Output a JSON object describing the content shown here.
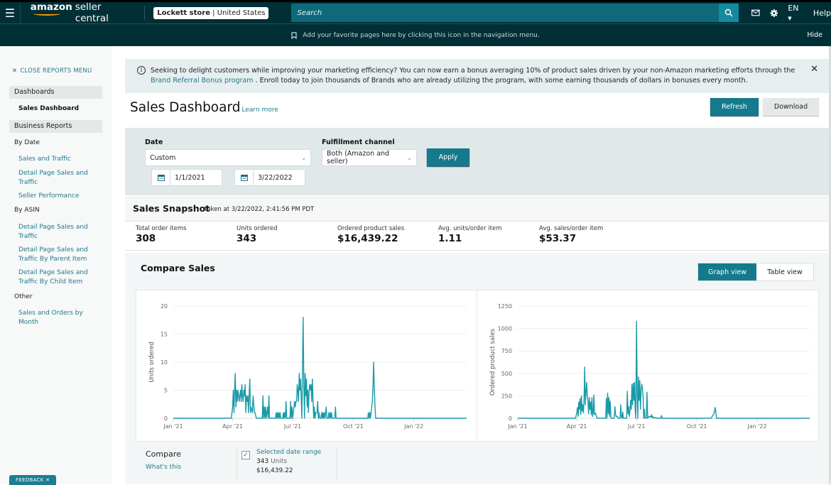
{
  "topbar": {
    "logo_brand": "amazon",
    "logo_text": "seller central",
    "store_name": "Lockett store",
    "store_region": "United States",
    "search_placeholder": "Search",
    "language": "EN",
    "help_label": "Help",
    "icons": [
      "menu-icon",
      "search-icon",
      "mail-icon",
      "gear-icon"
    ]
  },
  "favbar": {
    "message": "Add your favorite pages here by clicking this icon in the navigation menu.",
    "hide_label": "Hide"
  },
  "sidebar": {
    "close_label": "CLOSE REPORTS MENU",
    "groups": {
      "dashboards": "Dashboards",
      "business_reports": "Business Reports"
    },
    "active_item": "Sales Dashboard",
    "by_date": "By Date",
    "by_date_items": [
      "Sales and Traffic",
      "Detail Page Sales and Traffic",
      "Seller Performance"
    ],
    "by_asin": "By ASIN",
    "by_asin_items": [
      "Detail Page Sales and Traffic",
      "Detail Page Sales and Traffic By Parent Item",
      "Detail Page Sales and Traffic By Child Item"
    ],
    "other": "Other",
    "other_items": [
      "Sales and Orders by Month"
    ],
    "feedback_label": "FEEDBACK"
  },
  "banner": {
    "text_before": "Seeking to delight customers while improving your marketing efficiency? You can now earn a bonus averaging 10% of product sales driven by your non-Amazon marketing efforts through the ",
    "link_text": "Brand Referral Bonus program",
    "text_after": " . Enroll today to join thousands of Brands who are already utilizing the program, with some earning thousands of dollars in bonuses every month."
  },
  "page": {
    "title": "Sales Dashboard",
    "learn_more": "Learn more",
    "refresh_label": "Refresh",
    "download_label": "Download"
  },
  "filters": {
    "date_label": "Date",
    "date_value": "Custom",
    "start_date": "1/1/2021",
    "end_date": "3/22/2022",
    "fulfillment_label": "Fulfillment channel",
    "fulfillment_value": "Both (Amazon and seller)",
    "apply_label": "Apply"
  },
  "snapshot": {
    "title": "Sales Snapshot",
    "taken_at": "taken at 3/22/2022, 2:41:56 PM PDT",
    "metrics": [
      {
        "label": "Total order items",
        "value": "308"
      },
      {
        "label": "Units ordered",
        "value": "343"
      },
      {
        "label": "Ordered product sales",
        "value": "$16,439.22"
      },
      {
        "label": "Avg. units/order item",
        "value": "1.11"
      },
      {
        "label": "Avg. sales/order item",
        "value": "$53.37"
      }
    ]
  },
  "compare": {
    "title": "Compare Sales",
    "graph_view": "Graph view",
    "table_view": "Table view",
    "compare_label": "Compare",
    "whats_this": "What's this",
    "selected_range": "Selected date range",
    "units_value": "343",
    "units_word": "Units",
    "sales_value": "$16,439.22"
  },
  "colors": {
    "accent": "#157a8c",
    "nav_bg": "#002f36",
    "line": "#1a9aa8"
  },
  "chart_data": [
    {
      "type": "line",
      "title": "",
      "xlabel": "",
      "ylabel": "Units ordered",
      "ylim": [
        0,
        20
      ],
      "yticks": [
        "0",
        "5",
        "10",
        "15",
        "20"
      ],
      "xticks": [
        "Jan '21",
        "Apr '21",
        "Jul '21",
        "Oct '21",
        "Jan '22"
      ],
      "x_range_days": [
        0,
        445
      ],
      "grid": true,
      "series": [
        {
          "name": "Units ordered",
          "points": [
            [
              0,
              0
            ],
            [
              88,
              0
            ],
            [
              90,
              2
            ],
            [
              91,
              5
            ],
            [
              92,
              1
            ],
            [
              93,
              5
            ],
            [
              94,
              8
            ],
            [
              95,
              2
            ],
            [
              96,
              5
            ],
            [
              97,
              3
            ],
            [
              98,
              5
            ],
            [
              99,
              4
            ],
            [
              100,
              3
            ],
            [
              102,
              5
            ],
            [
              103,
              3
            ],
            [
              104,
              6
            ],
            [
              105,
              4
            ],
            [
              106,
              3
            ],
            [
              107,
              5
            ],
            [
              108,
              4
            ],
            [
              109,
              6
            ],
            [
              110,
              1
            ],
            [
              111,
              4
            ],
            [
              112,
              3
            ],
            [
              113,
              4
            ],
            [
              114,
              1
            ],
            [
              116,
              7
            ],
            [
              117,
              1
            ],
            [
              118,
              2
            ],
            [
              120,
              1
            ],
            [
              121,
              4
            ],
            [
              123,
              1
            ],
            [
              124,
              1
            ],
            [
              126,
              0
            ],
            [
              135,
              0
            ],
            [
              136,
              4
            ],
            [
              137,
              0
            ],
            [
              138,
              2
            ],
            [
              139,
              0
            ],
            [
              140,
              2
            ],
            [
              141,
              0
            ],
            [
              142,
              1
            ],
            [
              143,
              2
            ],
            [
              144,
              0
            ],
            [
              145,
              4
            ],
            [
              146,
              0
            ],
            [
              155,
              0
            ],
            [
              156,
              1
            ],
            [
              157,
              0
            ],
            [
              158,
              1
            ],
            [
              159,
              0
            ],
            [
              160,
              1
            ],
            [
              161,
              0
            ],
            [
              162,
              1
            ],
            [
              163,
              0
            ],
            [
              166,
              0
            ],
            [
              167,
              1
            ],
            [
              168,
              0
            ],
            [
              169,
              1
            ],
            [
              170,
              0
            ],
            [
              171,
              3
            ],
            [
              172,
              0
            ],
            [
              177,
              0
            ],
            [
              178,
              3
            ],
            [
              179,
              0
            ],
            [
              180,
              2
            ],
            [
              181,
              0
            ],
            [
              182,
              1
            ],
            [
              184,
              3
            ],
            [
              185,
              2
            ],
            [
              186,
              3
            ],
            [
              187,
              3
            ],
            [
              188,
              6
            ],
            [
              189,
              5
            ],
            [
              190,
              3
            ],
            [
              191,
              8
            ],
            [
              192,
              5
            ],
            [
              193,
              7
            ],
            [
              194,
              4
            ],
            [
              195,
              0
            ],
            [
              197,
              18
            ],
            [
              198,
              6
            ],
            [
              199,
              0
            ],
            [
              200,
              8
            ],
            [
              201,
              4
            ],
            [
              202,
              7
            ],
            [
              203,
              2
            ],
            [
              204,
              5
            ],
            [
              205,
              1
            ],
            [
              206,
              5
            ],
            [
              207,
              6
            ],
            [
              208,
              5
            ],
            [
              209,
              6
            ],
            [
              210,
              3
            ],
            [
              211,
              7
            ],
            [
              212,
              3
            ],
            [
              213,
              0
            ],
            [
              214,
              2
            ],
            [
              215,
              0
            ],
            [
              216,
              1
            ],
            [
              218,
              1
            ],
            [
              219,
              3
            ],
            [
              220,
              0
            ],
            [
              221,
              1
            ],
            [
              222,
              0
            ],
            [
              224,
              0
            ],
            [
              225,
              1
            ],
            [
              226,
              0
            ],
            [
              227,
              1
            ],
            [
              228,
              0
            ],
            [
              229,
              1
            ],
            [
              230,
              0
            ],
            [
              232,
              2
            ],
            [
              233,
              0
            ],
            [
              235,
              0
            ],
            [
              236,
              1
            ],
            [
              237,
              0
            ],
            [
              238,
              1
            ],
            [
              239,
              0
            ],
            [
              240,
              1
            ],
            [
              241,
              0
            ],
            [
              245,
              0
            ],
            [
              246,
              2
            ],
            [
              247,
              0
            ],
            [
              295,
              0
            ],
            [
              296,
              1
            ],
            [
              297,
              0
            ],
            [
              298,
              1
            ],
            [
              299,
              0
            ],
            [
              300,
              1
            ],
            [
              302,
              3
            ],
            [
              303,
              6
            ],
            [
              304,
              10
            ],
            [
              305,
              5
            ],
            [
              306,
              2
            ],
            [
              307,
              0
            ],
            [
              445,
              0
            ]
          ]
        }
      ]
    },
    {
      "type": "line",
      "title": "",
      "xlabel": "",
      "ylabel": "Ordered product sales",
      "ylim": [
        0,
        1250
      ],
      "yticks": [
        "0",
        "250",
        "500",
        "750",
        "1000",
        "1250"
      ],
      "xticks": [
        "Jan '21",
        "Apr '21",
        "Jul '21",
        "Oct '21",
        "Jan '22"
      ],
      "x_range_days": [
        0,
        445
      ],
      "grid": true,
      "series": [
        {
          "name": "Ordered product sales",
          "points": [
            [
              0,
              0
            ],
            [
              88,
              0
            ],
            [
              90,
              60
            ],
            [
              91,
              120
            ],
            [
              92,
              20
            ],
            [
              93,
              180
            ],
            [
              94,
              100
            ],
            [
              95,
              220
            ],
            [
              96,
              40
            ],
            [
              97,
              250
            ],
            [
              98,
              80
            ],
            [
              99,
              150
            ],
            [
              100,
              60
            ],
            [
              101,
              200
            ],
            [
              102,
              570
            ],
            [
              103,
              150
            ],
            [
              104,
              300
            ],
            [
              105,
              400
            ],
            [
              106,
              250
            ],
            [
              107,
              200
            ],
            [
              108,
              50
            ],
            [
              109,
              230
            ],
            [
              110,
              100
            ],
            [
              111,
              180
            ],
            [
              112,
              40
            ],
            [
              113,
              230
            ],
            [
              114,
              20
            ],
            [
              115,
              60
            ],
            [
              116,
              260
            ],
            [
              117,
              40
            ],
            [
              118,
              60
            ],
            [
              120,
              20
            ],
            [
              121,
              0
            ],
            [
              134,
              0
            ],
            [
              135,
              220
            ],
            [
              136,
              0
            ],
            [
              137,
              280
            ],
            [
              138,
              50
            ],
            [
              139,
              230
            ],
            [
              140,
              20
            ],
            [
              141,
              190
            ],
            [
              142,
              0
            ],
            [
              147,
              0
            ],
            [
              148,
              130
            ],
            [
              149,
              50
            ],
            [
              150,
              20
            ],
            [
              152,
              20
            ],
            [
              153,
              0
            ],
            [
              156,
              0
            ],
            [
              157,
              150
            ],
            [
              158,
              10
            ],
            [
              159,
              0
            ],
            [
              160,
              70
            ],
            [
              161,
              0
            ],
            [
              166,
              0
            ],
            [
              167,
              300
            ],
            [
              168,
              50
            ],
            [
              169,
              130
            ],
            [
              170,
              20
            ],
            [
              171,
              80
            ],
            [
              172,
              200
            ],
            [
              173,
              100
            ],
            [
              174,
              380
            ],
            [
              175,
              150
            ],
            [
              176,
              390
            ],
            [
              177,
              200
            ],
            [
              178,
              400
            ],
            [
              179,
              100
            ],
            [
              180,
              0
            ],
            [
              181,
              1080
            ],
            [
              182,
              300
            ],
            [
              183,
              0
            ],
            [
              184,
              460
            ],
            [
              185,
              200
            ],
            [
              186,
              420
            ],
            [
              187,
              100
            ],
            [
              188,
              300
            ],
            [
              189,
              380
            ],
            [
              190,
              330
            ],
            [
              191,
              250
            ],
            [
              192,
              0
            ],
            [
              193,
              100
            ],
            [
              194,
              0
            ],
            [
              196,
              0
            ],
            [
              197,
              290
            ],
            [
              198,
              0
            ],
            [
              200,
              20
            ],
            [
              202,
              20
            ],
            [
              203,
              10
            ],
            [
              204,
              40
            ],
            [
              205,
              10
            ],
            [
              206,
              20
            ],
            [
              207,
              0
            ],
            [
              210,
              10
            ],
            [
              212,
              0
            ],
            [
              218,
              0
            ],
            [
              219,
              30
            ],
            [
              220,
              0
            ],
            [
              295,
              0
            ],
            [
              297,
              30
            ],
            [
              299,
              50
            ],
            [
              301,
              120
            ],
            [
              302,
              60
            ],
            [
              303,
              0
            ],
            [
              445,
              0
            ]
          ]
        }
      ]
    }
  ]
}
